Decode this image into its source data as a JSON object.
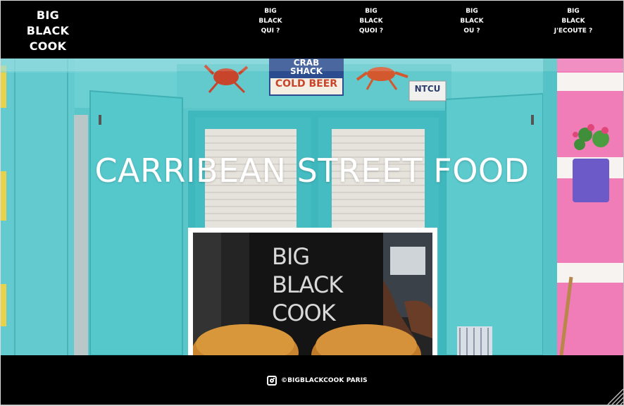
{
  "header": {
    "logo_lines": [
      "BIG",
      "BLACK",
      "COOK"
    ],
    "nav": [
      {
        "lines": [
          "BIG",
          "BLACK",
          "QUI ?"
        ]
      },
      {
        "lines": [
          "BIG",
          "BLACK",
          "QUOI ?"
        ]
      },
      {
        "lines": [
          "BIG",
          "BLACK",
          "OU ?"
        ]
      },
      {
        "lines": [
          "BIG",
          "BLACK",
          "J'ECOUTE ?"
        ]
      }
    ]
  },
  "hero": {
    "title": "CARRIBEAN STREET FOOD",
    "sign_lines": [
      "CRAB",
      "SHACK",
      "COLD BEER"
    ],
    "small_sign": "NTCU",
    "photo": {
      "apron_lines": [
        "BIG",
        "BLACK",
        "COOK"
      ]
    }
  },
  "footer": {
    "icon": "instagram-icon",
    "text": "©BIGBLACKCOOK PARIS"
  },
  "colors": {
    "bar": "#000000",
    "wall": "#56c4c8",
    "pink": "#f16fb3",
    "text": "#ffffff"
  }
}
